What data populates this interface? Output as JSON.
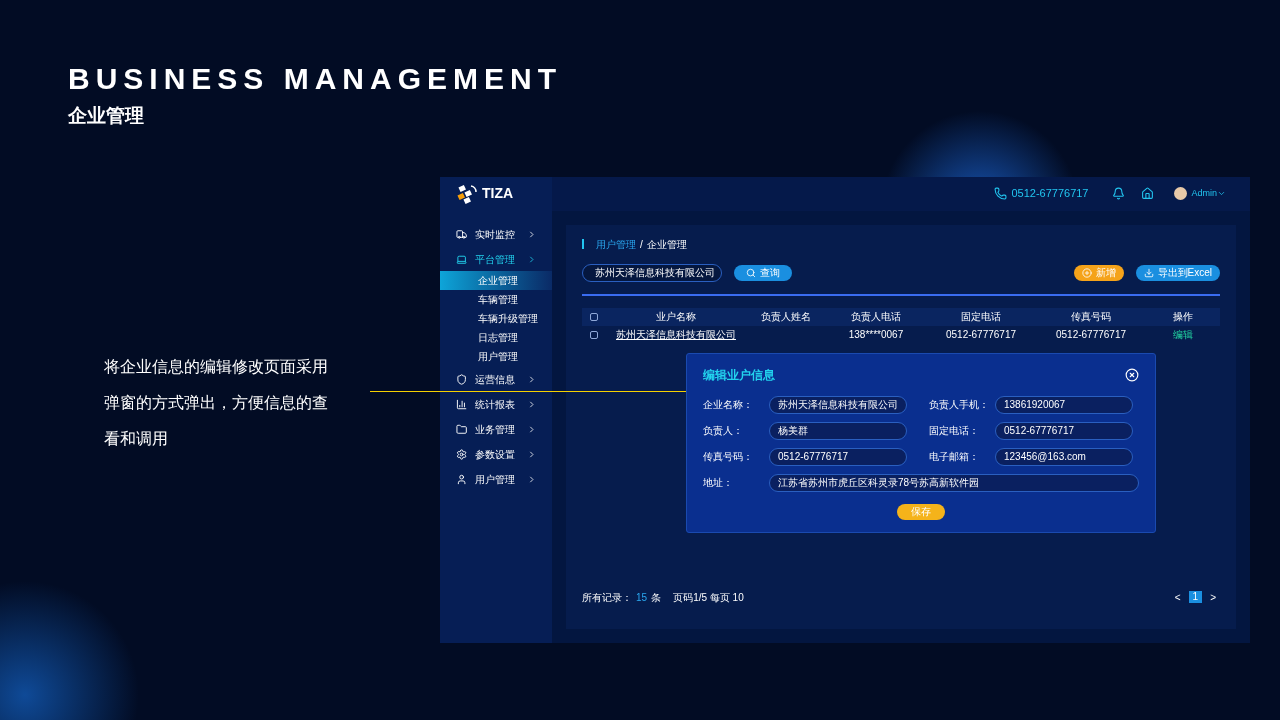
{
  "slide": {
    "title": "BUSINESS MANAGEMENT",
    "subtitle": "企业管理",
    "caption": "将企业信息的编辑修改页面采用弹窗的方式弹出，方便信息的查看和调用"
  },
  "app": {
    "logo": "TIZA",
    "topbar": {
      "phone": "0512-67776717",
      "user": "Admin"
    },
    "sidebar": [
      {
        "kind": "truck",
        "label": "实时监控",
        "selected": false
      },
      {
        "kind": "laptop",
        "label": "平台管理",
        "selected": true,
        "expanded": true,
        "children": [
          {
            "label": "企业管理",
            "selected": true
          },
          {
            "label": "车辆管理",
            "selected": false
          },
          {
            "label": "车辆升级管理",
            "selected": false
          },
          {
            "label": "日志管理",
            "selected": false
          },
          {
            "label": "用户管理",
            "selected": false
          }
        ]
      },
      {
        "kind": "shield",
        "label": "运营信息",
        "selected": false
      },
      {
        "kind": "chart",
        "label": "统计报表",
        "selected": false
      },
      {
        "kind": "folder",
        "label": "业务管理",
        "selected": false
      },
      {
        "kind": "gear",
        "label": "参数设置",
        "selected": false
      },
      {
        "kind": "user",
        "label": "用户管理",
        "selected": false
      }
    ],
    "breadcrumb": {
      "items": [
        "用户管理",
        "企业管理"
      ],
      "separator": "/"
    },
    "search": {
      "value": "苏州天泽信息科技有限公司",
      "button": "查询"
    },
    "actions": [
      {
        "kind": "add",
        "label": "新增"
      },
      {
        "kind": "export",
        "label": "导出到Excel"
      }
    ],
    "table": {
      "select_all": false,
      "columns": [
        "业户名称",
        "负责人姓名",
        "负责人电话",
        "固定电话",
        "传真号码",
        "操作"
      ],
      "rows": [
        {
          "checked": false,
          "company": "苏州天泽信息科技有限公司",
          "phone": "138****0067",
          "landline": "0512-67776717",
          "fax": "0512-67776717",
          "action": "编辑"
        }
      ]
    },
    "footer": {
      "records_label": "所有记录：",
      "records": "15",
      "records_unit": "条",
      "paging": "页码1/5 每页 10"
    },
    "pagination": {
      "prev": "<",
      "pages": [
        {
          "label": "1",
          "selected": true
        }
      ],
      "next": ">"
    },
    "modal": {
      "title": "编辑业户信息",
      "fields": [
        {
          "kind": "half",
          "label": "企业名称：",
          "value": "苏州天泽信息科技有限公司"
        },
        {
          "kind": "half",
          "label": "负责人手机：",
          "value": "13861920067"
        },
        {
          "kind": "half",
          "label": "负责人：",
          "value": "杨美群"
        },
        {
          "kind": "half",
          "label": "固定电话：",
          "value": "0512-67776717"
        },
        {
          "kind": "half",
          "label": "传真号码：",
          "value": "0512-67776717"
        },
        {
          "kind": "half",
          "label": "电子邮箱：",
          "value": "123456@163.com"
        },
        {
          "kind": "wide",
          "label": "地址：",
          "value": "江苏省苏州市虎丘区科灵录78号苏高新软件园"
        }
      ],
      "save": "保存"
    }
  }
}
